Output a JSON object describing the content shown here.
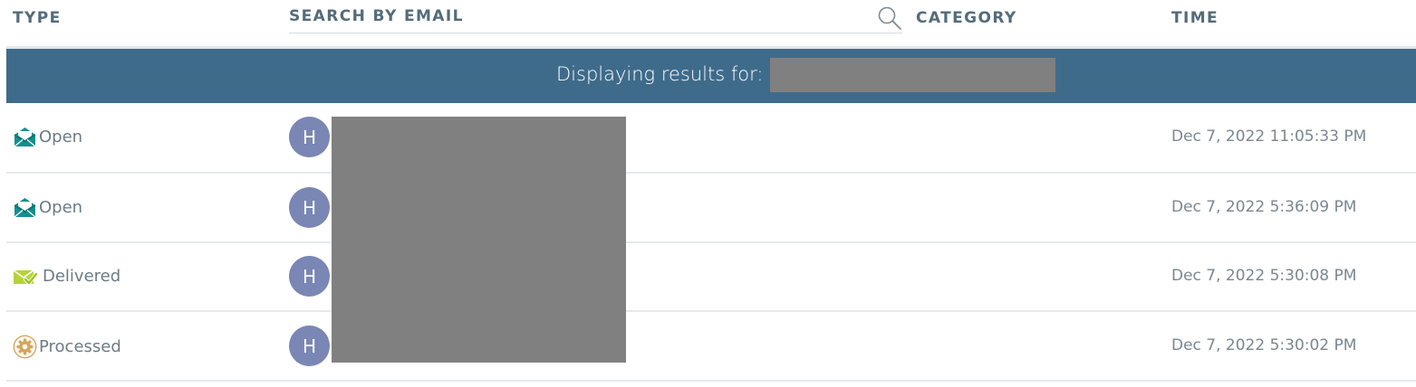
{
  "header": {
    "type_label": "TYPE",
    "search_placeholder": "SEARCH BY EMAIL",
    "search_value": "",
    "category_label": "CATEGORY",
    "time_label": "TIME"
  },
  "banner": {
    "text": "Displaying results for:"
  },
  "rows": [
    {
      "type": "Open",
      "type_icon": "open-envelope-icon",
      "avatar": "H",
      "time": "Dec 7, 2022 11:05:33 PM"
    },
    {
      "type": "Open",
      "type_icon": "open-envelope-icon",
      "avatar": "H",
      "time": "Dec 7, 2022 5:36:09 PM"
    },
    {
      "type": "Delivered",
      "type_icon": "delivered-envelope-check-icon",
      "avatar": "H",
      "time": "Dec 7, 2022 5:30:08 PM"
    },
    {
      "type": "Processed",
      "type_icon": "processed-gear-icon",
      "avatar": "H",
      "time": "Dec 7, 2022 5:30:02 PM"
    }
  ],
  "colors": {
    "banner_bg": "#3f6b8b",
    "avatar_bg": "#7a87b5",
    "open_icon": "#12908e",
    "delivered_icon": "#b7d33a",
    "processed_icon": "#d9a45b",
    "redaction": "#808080"
  }
}
